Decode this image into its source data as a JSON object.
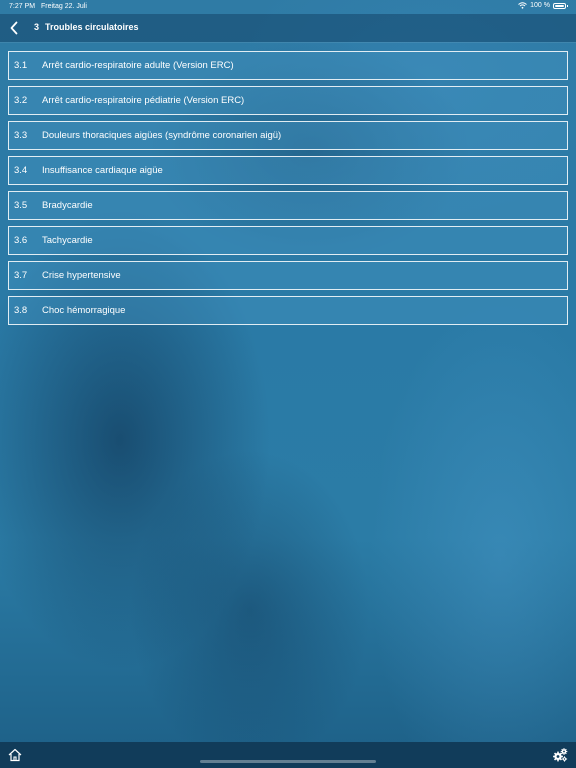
{
  "status_bar": {
    "time": "7:27 PM",
    "date": "Freitag 22. Juli",
    "battery": "100 %",
    "battery_level": 1.0
  },
  "nav": {
    "number": "3",
    "title": "Troubles circulatoires",
    "back_icon": "chevron-left-icon"
  },
  "items": [
    {
      "num": "3.1",
      "label": "Arrêt cardio-respiratoire adulte (Version ERC)"
    },
    {
      "num": "3.2",
      "label": "Arrêt cardio-respiratoire pédiatrie (Version ERC)"
    },
    {
      "num": "3.3",
      "label": "Douleurs thoraciques aigües (syndrôme coronarien aigü)"
    },
    {
      "num": "3.4",
      "label": "Insuffisance cardiaque aigüe"
    },
    {
      "num": "3.5",
      "label": "Bradycardie"
    },
    {
      "num": "3.6",
      "label": "Tachycardie"
    },
    {
      "num": "3.7",
      "label": "Crise hypertensive"
    },
    {
      "num": "3.8",
      "label": "Choc hémorragique"
    }
  ],
  "tab_bar": {
    "home_icon": "home-icon",
    "settings_icon": "gears-icon"
  },
  "colors": {
    "background": "#2f7fa8",
    "tab_bar": "#113c5a",
    "text": "#ffffff"
  }
}
